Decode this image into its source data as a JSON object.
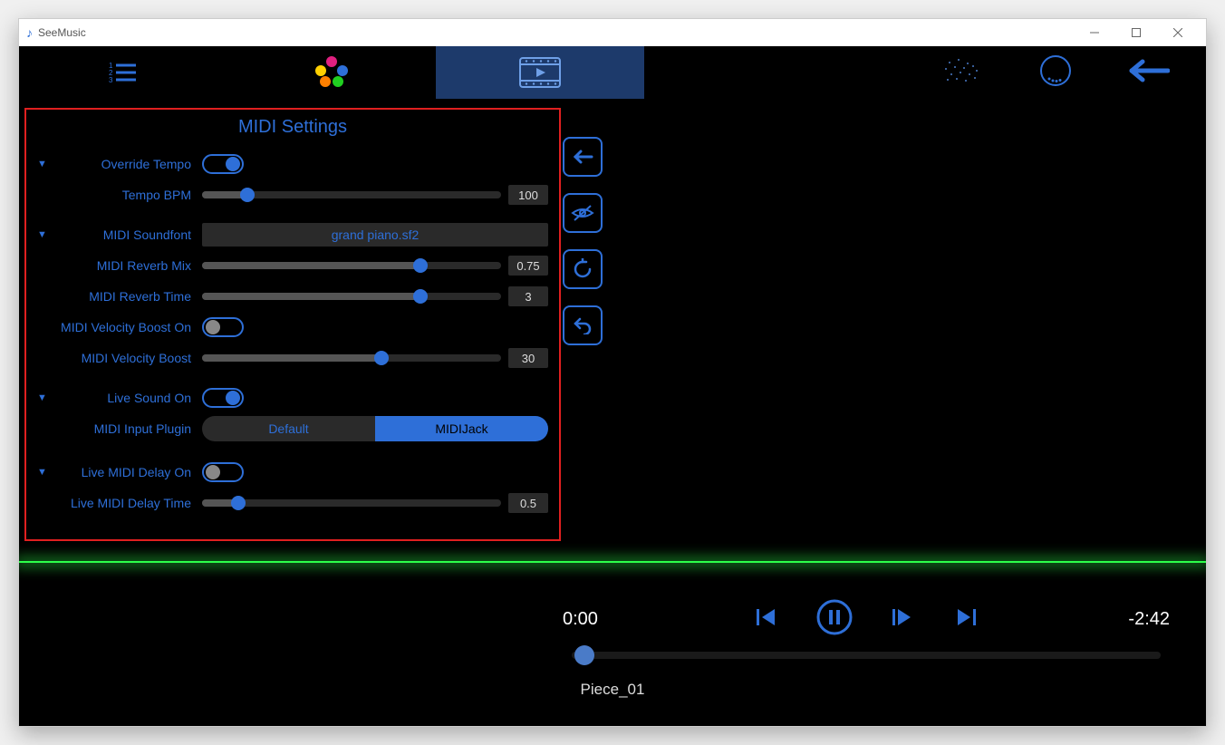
{
  "window": {
    "title": "SeeMusic"
  },
  "panel": {
    "title": "MIDI Settings",
    "override_tempo_label": "Override Tempo",
    "override_tempo_on": true,
    "tempo_bpm_label": "Tempo BPM",
    "tempo_bpm_value": "100",
    "tempo_bpm_pct": 15,
    "soundfont_label": "MIDI Soundfont",
    "soundfont_value": "grand piano.sf2",
    "reverb_mix_label": "MIDI Reverb Mix",
    "reverb_mix_value": "0.75",
    "reverb_mix_pct": 73,
    "reverb_time_label": "MIDI Reverb Time",
    "reverb_time_value": "3",
    "reverb_time_pct": 73,
    "vel_boost_on_label": "MIDI Velocity Boost On",
    "vel_boost_on": false,
    "vel_boost_label": "MIDI Velocity Boost",
    "vel_boost_value": "30",
    "vel_boost_pct": 60,
    "live_sound_label": "Live Sound On",
    "live_sound_on": true,
    "input_plugin_label": "MIDI Input Plugin",
    "input_plugin_options": {
      "a": "Default",
      "b": "MIDIJack"
    },
    "live_delay_on_label": "Live MIDI Delay On",
    "live_delay_on": false,
    "live_delay_time_label": "Live MIDI Delay Time",
    "live_delay_time_value": "0.5",
    "live_delay_time_pct": 12
  },
  "transport": {
    "elapsed": "0:00",
    "remaining": "-2:42",
    "piece": "Piece_01"
  }
}
